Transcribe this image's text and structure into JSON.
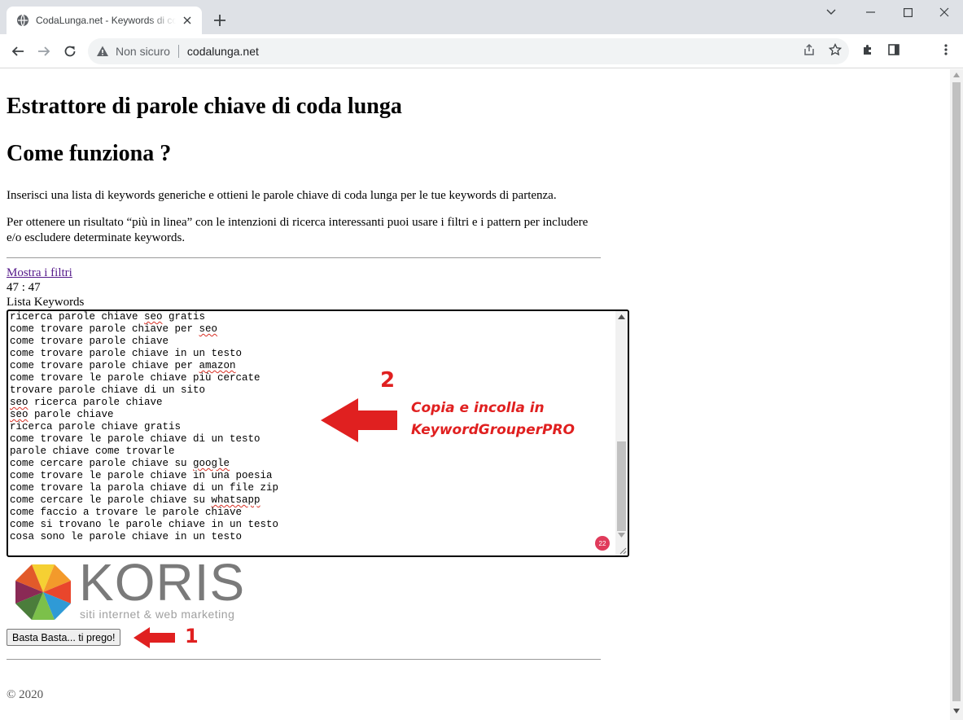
{
  "browser": {
    "tab_title": "CodaLunga.net - Keywords di coda lunga",
    "security_label": "Non sicuro",
    "url": "codalunga.net"
  },
  "page": {
    "heading_main": "Estrattore di parole chiave di coda lunga",
    "heading_how": "Come funziona ?",
    "intro": "Inserisci una lista di keywords generiche e ottieni le parole chiave di coda lunga per le tue keywords di partenza.",
    "filters_note": "Per ottenere un risultato “più in linea” con le intenzioni di ricerca interessanti puoi usare i filtri e i pattern per includere e/o escludere determinate keywords.",
    "show_filters_link": "Mostra i filtri",
    "counter": "47 : 47",
    "list_label": "Lista Keywords",
    "keywords": [
      [
        "ricerca parole chiave ",
        "seo",
        " gratis"
      ],
      [
        "come trovare parole chiave per ",
        "seo",
        ""
      ],
      [
        "come trovare parole chiave",
        "",
        ""
      ],
      [
        "come trovare parole chiave in un testo",
        "",
        ""
      ],
      [
        "come trovare parole chiave per ",
        "amazon",
        ""
      ],
      [
        "come trovare le parole chiave più cercate",
        "",
        ""
      ],
      [
        "trovare parole chiave di un sito",
        "",
        ""
      ],
      [
        "",
        "seo",
        " ricerca parole chiave"
      ],
      [
        "",
        "seo",
        " parole chiave"
      ],
      [
        "ricerca parole chiave gratis",
        "",
        ""
      ],
      [
        "come trovare le parole chiave di un testo",
        "",
        ""
      ],
      [
        "parole chiave come trovarle",
        "",
        ""
      ],
      [
        "come cercare parole chiave su ",
        "google",
        ""
      ],
      [
        "come trovare le parole chiave in una poesia",
        "",
        ""
      ],
      [
        "come trovare la parola chiave di un file zip",
        "",
        ""
      ],
      [
        "come cercare le parole chiave su ",
        "whatsapp",
        ""
      ],
      [
        "come faccio a trovare le parole chiave",
        "",
        ""
      ],
      [
        "come si trovano le parole chiave in un testo",
        "",
        ""
      ],
      [
        "cosa sono le parole chiave in un testo",
        "",
        ""
      ]
    ],
    "grammarly_count": "22",
    "annotation_2_number": "2",
    "annotation_2_line1": "Copia e incolla in",
    "annotation_2_line2": "KeywordGrouperPRO",
    "logo_name": "KORIS",
    "logo_tagline": "siti internet & web marketing",
    "stop_button": "Basta Basta... ti prego!",
    "annotation_1_number": "1",
    "footer": "© 2020"
  },
  "colors": {
    "annotation_red": "#e02020",
    "visited_link": "#551a8b"
  }
}
